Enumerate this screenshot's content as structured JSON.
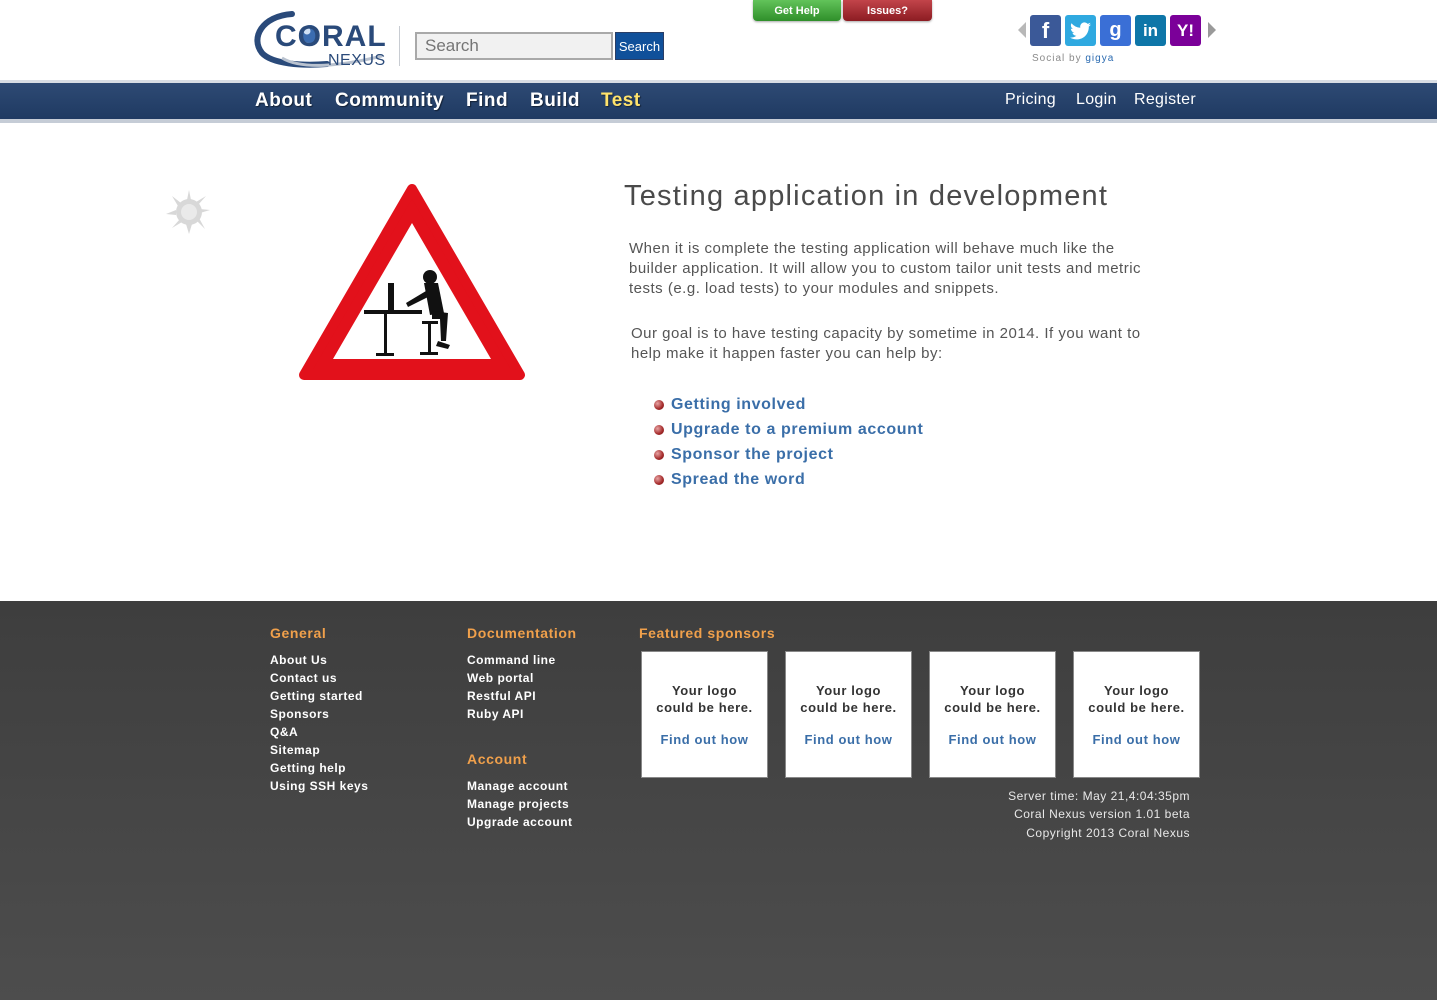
{
  "header": {
    "logo_main": "CORAL",
    "logo_sub": "NEXUS",
    "search_placeholder": "Search",
    "search_button": "Search",
    "tab_gethelp": "Get Help",
    "tab_issues": "Issues?",
    "social": {
      "icons": [
        "facebook-icon",
        "twitter-icon",
        "google-icon",
        "linkedin-icon",
        "yahoo-icon"
      ],
      "caption_prefix": "Social by",
      "caption_brand": "gigya"
    }
  },
  "nav": {
    "left": [
      "About",
      "Community",
      "Find",
      "Build",
      "Test"
    ],
    "active": "Test",
    "right": [
      "Pricing",
      "Login",
      "Register"
    ]
  },
  "main": {
    "title": "Testing application in development",
    "paragraph1": "When it is complete the testing application will behave much like the builder application.  It will allow you to custom tailor unit tests and metric tests (e.g. load tests) to your modules and snippets.",
    "paragraph2": "Our goal is to have testing capacity by sometime in 2014.  If you want to help make it happen faster you can help by:",
    "help_links": [
      "Getting involved",
      "Upgrade to a premium account",
      "Sponsor the project",
      "Spread the word"
    ]
  },
  "footer": {
    "general": {
      "heading": "General",
      "items": [
        "About Us",
        "Contact us",
        "Getting started",
        "Sponsors",
        "Q&A",
        "Sitemap",
        "Getting help",
        "Using SSH keys"
      ]
    },
    "documentation": {
      "heading": "Documentation",
      "items": [
        "Command line",
        "Web portal",
        "Restful API",
        "Ruby API"
      ]
    },
    "account": {
      "heading": "Account",
      "items": [
        "Manage account",
        "Manage projects",
        "Upgrade account"
      ]
    },
    "sponsors": {
      "heading": "Featured sponsors",
      "text_line1": "Your logo",
      "text_line2": "could be here.",
      "link": "Find out how"
    },
    "server_time": "Server time: May 21,4:04:35pm",
    "version": "Coral Nexus version 1.01 beta",
    "copyright": "Copyright 2013 Coral Nexus"
  },
  "colors": {
    "nav_bg": "#1f3a62",
    "nav_active": "#ffe36c",
    "link": "#3a6ea8",
    "footer_heading": "#f0a04b",
    "warning_red": "#e2111b"
  }
}
